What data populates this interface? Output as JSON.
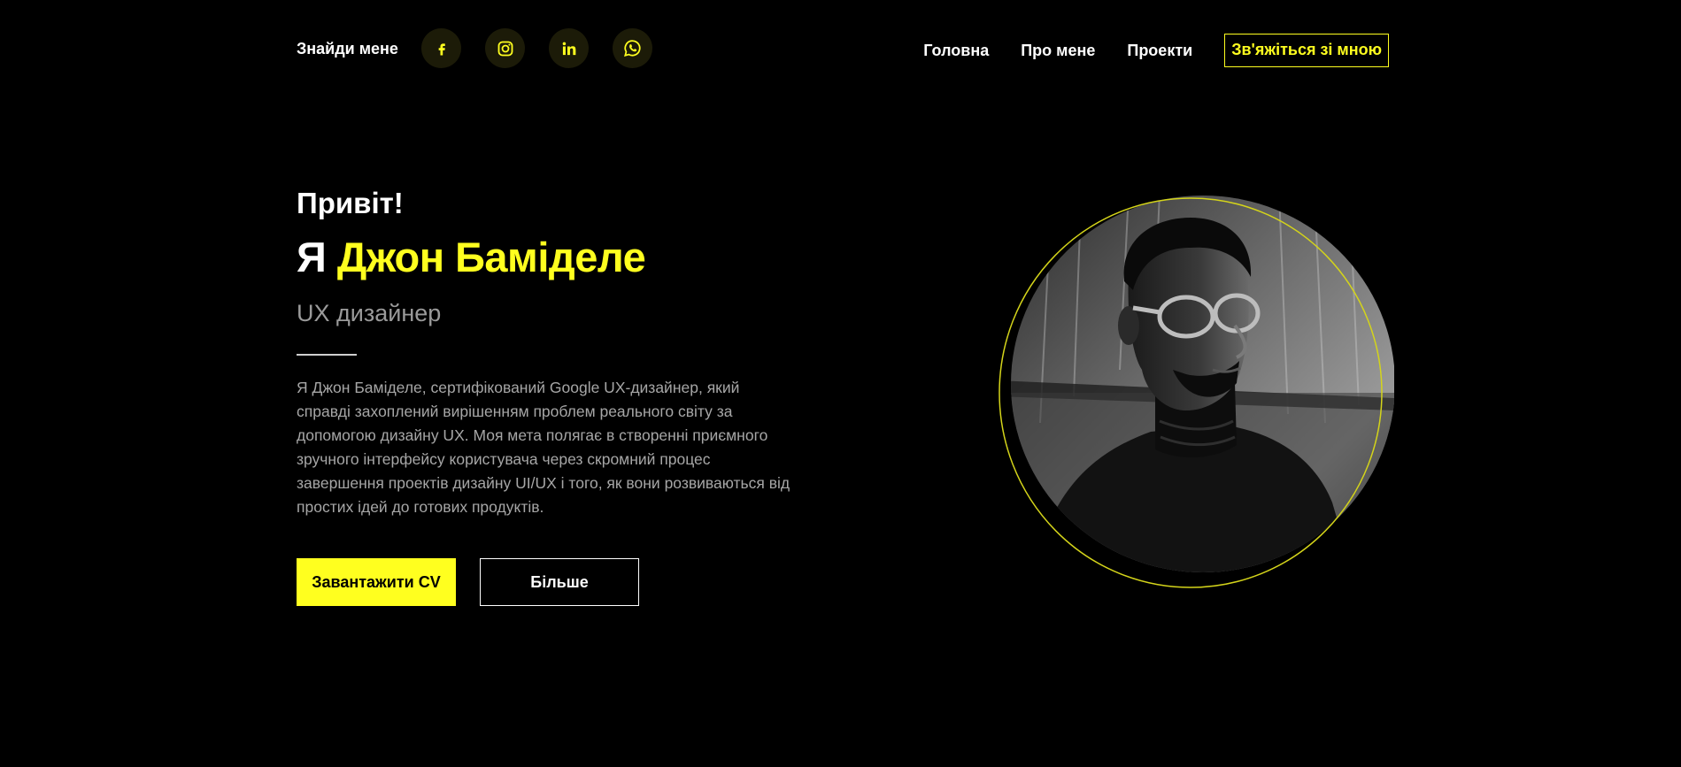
{
  "header": {
    "find_me": "Знайди мене",
    "socials": [
      {
        "icon": "facebook-icon"
      },
      {
        "icon": "instagram-icon"
      },
      {
        "icon": "linkedin-icon"
      },
      {
        "icon": "whatsapp-icon"
      }
    ],
    "nav": {
      "home": "Головна",
      "about": "Про мене",
      "projects": "Проекти",
      "contact": "Зв'яжіться зі мною"
    }
  },
  "hero": {
    "greeting": "Привіт!",
    "name_prefix": "Я",
    "name": "Джон Баміделе",
    "role": "UX дизайнер",
    "bio": "Я Джон Баміделе, сертифікований Google UX-дизайнер, який справді захоплений вирішенням проблем реального світу за допомогою дизайну UX. Моя мета полягає в створенні приємного зручного інтерфейсу користувача через скромний процес завершення проектів дизайну UI/UX і того, як вони розвиваються від простих ідей до готових продуктів.",
    "download_cv": "Завантажити CV",
    "more": "Більше"
  },
  "portrait": {
    "description_icon": "person-photo"
  },
  "colors": {
    "background": "#000000",
    "accent": "#ffff1f",
    "text": "#ffffff",
    "muted": "#a6a6a6",
    "social_bg": "#1c1b08"
  }
}
